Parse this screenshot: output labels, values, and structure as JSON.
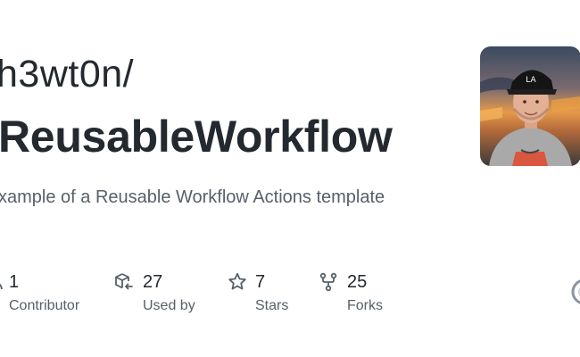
{
  "header": {
    "owner": "h3wt0n/",
    "repo_name": "ReusableWorkflow",
    "description": "xample of a Reusable Workflow Actions template"
  },
  "avatar": {
    "icon": "user-avatar-photo"
  },
  "stats": [
    {
      "value": "1",
      "label": "Contributor",
      "icon": "people-icon"
    },
    {
      "value": "27",
      "label": "Used by",
      "icon": "package-dependents-icon"
    },
    {
      "value": "7",
      "label": "Stars",
      "icon": "star-icon"
    },
    {
      "value": "25",
      "label": "Forks",
      "icon": "repo-forked-icon"
    }
  ],
  "colors": {
    "text_primary": "#24292f",
    "text_secondary": "#57606a",
    "background": "#ffffff"
  }
}
